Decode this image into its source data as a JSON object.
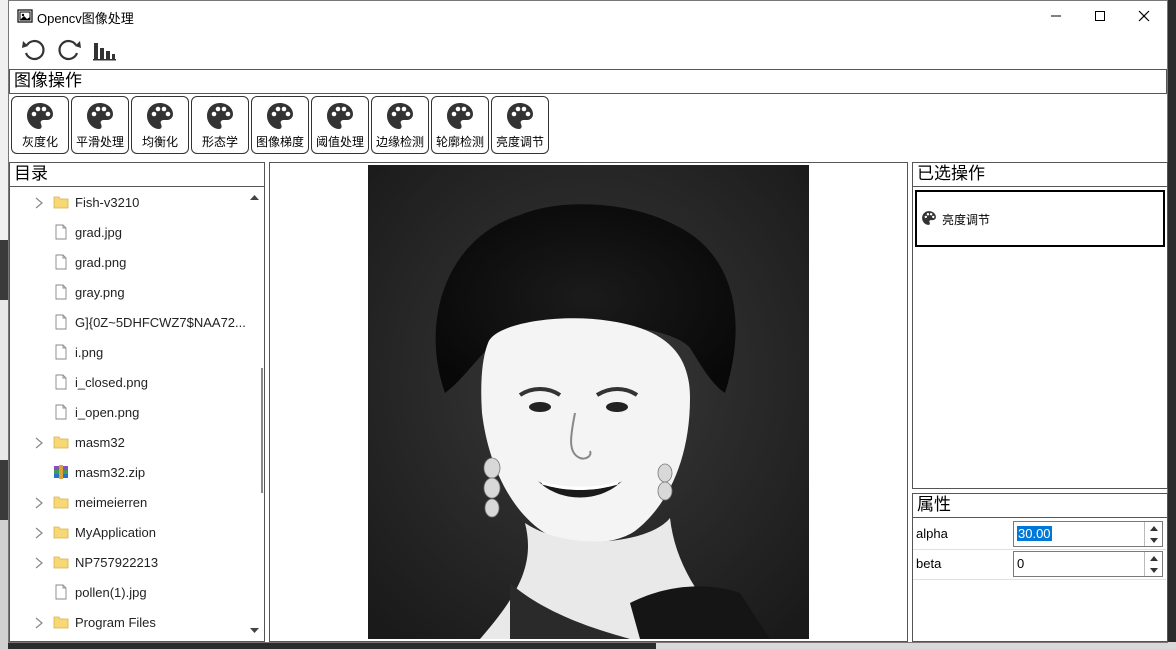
{
  "window": {
    "title": "Opencv图像处理"
  },
  "toolbar": {
    "undo": "undo-icon",
    "redo": "redo-icon",
    "histogram": "histogram-icon"
  },
  "operations": {
    "header": "图像操作",
    "items": [
      "灰度化",
      "平滑处理",
      "均衡化",
      "形态学",
      "图像梯度",
      "阈值处理",
      "边缘检测",
      "轮廓检测",
      "亮度调节"
    ]
  },
  "directory": {
    "title": "目录",
    "items": [
      {
        "name": "Fish-v3210",
        "type": "folder"
      },
      {
        "name": "grad.jpg",
        "type": "file"
      },
      {
        "name": "grad.png",
        "type": "file"
      },
      {
        "name": "gray.png",
        "type": "file"
      },
      {
        "name": "G]{0Z~5DHFCWZ7$NAA72...",
        "type": "file"
      },
      {
        "name": "i.png",
        "type": "file"
      },
      {
        "name": "i_closed.png",
        "type": "file"
      },
      {
        "name": "i_open.png",
        "type": "file"
      },
      {
        "name": "masm32",
        "type": "folder"
      },
      {
        "name": "masm32.zip",
        "type": "zip"
      },
      {
        "name": "meimeierren",
        "type": "folder"
      },
      {
        "name": "MyApplication",
        "type": "folder"
      },
      {
        "name": "NP757922213",
        "type": "folder"
      },
      {
        "name": "pollen(1).jpg",
        "type": "file"
      },
      {
        "name": "Program Files",
        "type": "folder"
      }
    ]
  },
  "selected_ops": {
    "title": "已选操作",
    "items": [
      "亮度调节"
    ]
  },
  "properties": {
    "title": "属性",
    "rows": [
      {
        "name": "alpha",
        "value": "30.00"
      },
      {
        "name": "beta",
        "value": "0"
      }
    ]
  },
  "colors": {
    "accent": "#0078d7",
    "folder": "#f8d775"
  }
}
